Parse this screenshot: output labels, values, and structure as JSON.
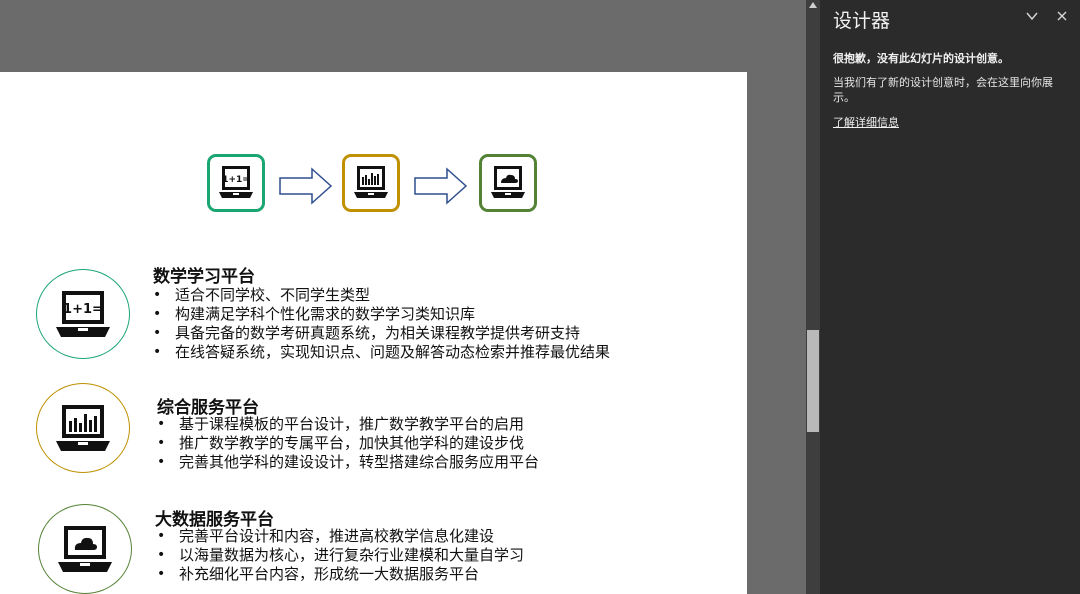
{
  "colors": {
    "green": "#1aa673",
    "gold": "#bf9000",
    "olive": "#548235",
    "arrow": "#2f4f8f"
  },
  "flow": {
    "icons": [
      "calculator-laptop-icon",
      "bar-chart-laptop-icon",
      "cloud-laptop-icon"
    ],
    "box1_text": "1+1="
  },
  "sections": [
    {
      "title": "数学学习平台",
      "icon": "calculator-laptop-icon",
      "icon_text": "1+1=",
      "bullets": [
        "适合不同学校、不同学生类型",
        "构建满足学科个性化需求的数学学习类知识库",
        "具备完备的数学考研真题系统，为相关课程教学提供考研支持",
        "在线答疑系统，实现知识点、问题及解答动态检索并推荐最优结果"
      ]
    },
    {
      "title": "综合服务平台",
      "icon": "bar-chart-laptop-icon",
      "bullets": [
        "基于课程模板的平台设计，推广数学教学平台的启用",
        "推广数学教学的专属平台，加快其他学科的建设步伐",
        "完善其他学科的建设设计，转型搭建综合服务应用平台"
      ]
    },
    {
      "title": "大数据服务平台",
      "icon": "cloud-laptop-icon",
      "bullets": [
        "完善平台设计和内容，推进高校教学信息化建设",
        "以海量数据为核心，进行复杂行业建模和大量自学习",
        "补充细化平台内容，形成统一大数据服务平台"
      ]
    }
  ],
  "designer": {
    "title": "设计器",
    "message": "很抱歉，没有此幻灯片的设计创意。",
    "hint": "当我们有了新的设计创意时，会在这里向你展示。",
    "link": "了解详细信息",
    "collapse_icon": "chevron-down-icon",
    "close_icon": "close-icon"
  }
}
